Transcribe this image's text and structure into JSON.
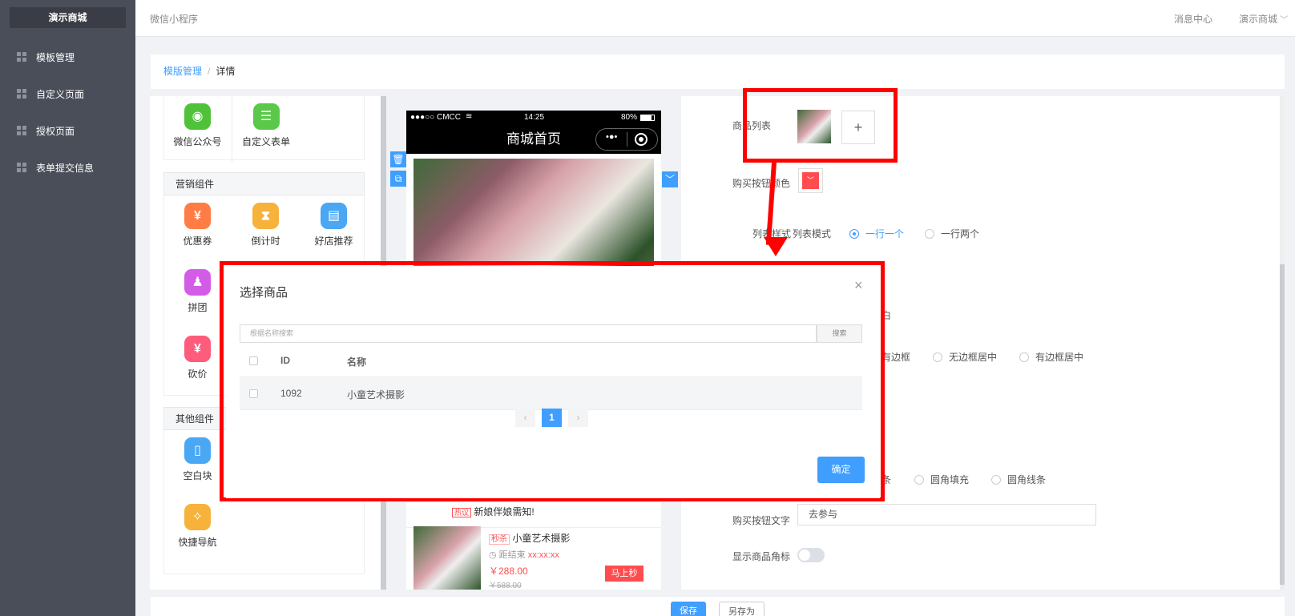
{
  "sidebar": {
    "brand": "演示商城",
    "items": [
      {
        "label": "模板管理"
      },
      {
        "label": "自定义页面"
      },
      {
        "label": "授权页面"
      },
      {
        "label": "表单提交信息"
      }
    ]
  },
  "topbar": {
    "title": "微信小程序",
    "message_center": "消息中心",
    "shop_menu": "演示商城"
  },
  "breadcrumb": {
    "link": "模版管理",
    "separator": "/",
    "current": "详情"
  },
  "components": {
    "top_items": [
      {
        "label": "微信公众号",
        "icon": "wechat-icon",
        "color": "#4fc23a"
      },
      {
        "label": "自定义表单",
        "icon": "form-icon",
        "color": "#5ac94a"
      }
    ],
    "marketing": {
      "title": "营销组件",
      "items": [
        {
          "label": "优惠券",
          "icon": "coupon-icon",
          "color": "#ff7c45"
        },
        {
          "label": "倒计时",
          "icon": "hourglass-icon",
          "color": "#f7b23b"
        },
        {
          "label": "好店推荐",
          "icon": "shop-icon",
          "color": "#4aa7f4"
        },
        {
          "label": "拼团",
          "icon": "group-icon",
          "color": "#d35ce6"
        },
        {
          "label": "砍价",
          "icon": "bargain-icon",
          "color": "#ff5b7a"
        }
      ]
    },
    "other": {
      "title": "其他组件",
      "items": [
        {
          "label": "空白块",
          "icon": "blank-block-icon",
          "color": "#4aa7f4"
        },
        {
          "label": "快捷导航",
          "icon": "compass-icon",
          "color": "#f7b23b"
        }
      ]
    }
  },
  "phone": {
    "carrier": "●●●○○ CMCC",
    "time": "14:25",
    "battery": "80%",
    "title": "商城首页",
    "notice_tag": "热议",
    "notice_text": "新娘伴娘需知!",
    "product": {
      "tag": "秒杀",
      "name": "小童艺术摄影",
      "countdown_label": "距结束",
      "countdown": "xx:xx:xx",
      "price": "￥288.00",
      "original_price": "￥588.00",
      "button": "马上秒"
    }
  },
  "settings": {
    "product_list_label": "商品列表",
    "add_symbol": "+",
    "buy_color_label": "购买按钮颜色",
    "buy_color": "#ff4d4f",
    "list_style_label": "列表样式",
    "list_style_options": [
      "列表模式",
      "一行一个",
      "一行两个"
    ],
    "list_style_selected": 1,
    "partial_bai": "白",
    "border_options": [
      "有边框",
      "无边框居中",
      "有边框居中"
    ],
    "button_style_options": [
      "条",
      "圆角填充",
      "圆角线条"
    ],
    "buy_text_label": "购买按钮文字",
    "buy_text_value": "去参与",
    "show_corner_label": "显示商品角标",
    "show_corner_on": false
  },
  "footer": {
    "save": "保存",
    "save_as": "另存为"
  },
  "modal": {
    "title": "选择商品",
    "close": "×",
    "search_placeholder": "根据名称搜索",
    "search_button": "搜索",
    "columns": [
      "ID",
      "名称"
    ],
    "rows": [
      {
        "id": "1092",
        "name": "小童艺术摄影"
      }
    ],
    "page_prev": "‹",
    "page_current": "1",
    "page_next": "›",
    "confirm": "确定"
  },
  "colors": {
    "sidebar": "#4a4e59",
    "accent": "#409eff",
    "annotation": "#ff0000"
  }
}
